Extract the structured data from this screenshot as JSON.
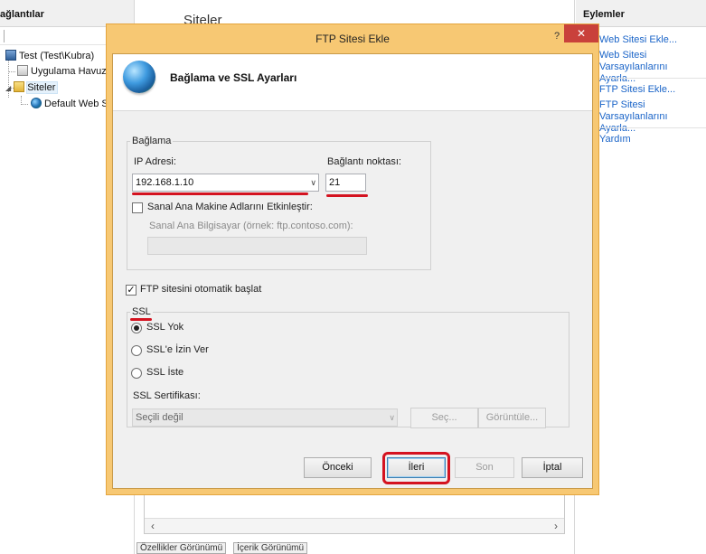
{
  "left": {
    "header": "ağlantılar",
    "tree": {
      "server": "Test (Test\\Kubra)",
      "app_pools": "Uygulama Havuzlar",
      "sites": "Siteler",
      "default_site": "Default Web Site"
    }
  },
  "center": {
    "header": "Siteler",
    "tabs": [
      "Özellikler Görünümü",
      "İçerik Görünümü"
    ]
  },
  "right": {
    "header": "Eylemler",
    "actions": [
      "Web Sitesi Ekle...",
      "Web Sitesi Varsayılanlarını Ayarla...",
      "FTP Sitesi Ekle...",
      "FTP Sitesi Varsayılanlarını Ayarla...",
      "Yardım"
    ]
  },
  "dialog": {
    "title": "FTP Sitesi Ekle",
    "help": "?",
    "close": "✕",
    "banner_title": "Bağlama ve SSL Ayarları",
    "binding": {
      "legend": "Bağlama",
      "ip_label": "IP Adresi:",
      "ip_value": "192.168.1.10",
      "port_label": "Bağlantı noktası:",
      "port_value": "21",
      "virtual_host_checkbox": "Sanal Ana Makine Adlarını Etkinleştir:",
      "virtual_host_checked": false,
      "virtual_host_label": "Sanal Ana Bilgisayar (örnek: ftp.contoso.com):",
      "virtual_host_value": ""
    },
    "autostart": {
      "label": "FTP sitesini otomatik başlat",
      "checked": true
    },
    "ssl": {
      "legend": "SSL",
      "options": [
        "SSL Yok",
        "SSL'e İzin Ver",
        "SSL İste"
      ],
      "selected": "SSL Yok",
      "cert_label": "SSL Sertifikası:",
      "cert_value": "Seçili değil",
      "select_button": "Seç...",
      "view_button": "Görüntüle..."
    },
    "buttons": {
      "previous": "Önceki",
      "next": "İleri",
      "finish": "Son",
      "cancel": "İptal"
    }
  },
  "colors": {
    "dialog_frame": "#f7c873",
    "annotation_red": "#d41320",
    "link_blue": "#1a64c8",
    "close_red": "#c9413b"
  }
}
